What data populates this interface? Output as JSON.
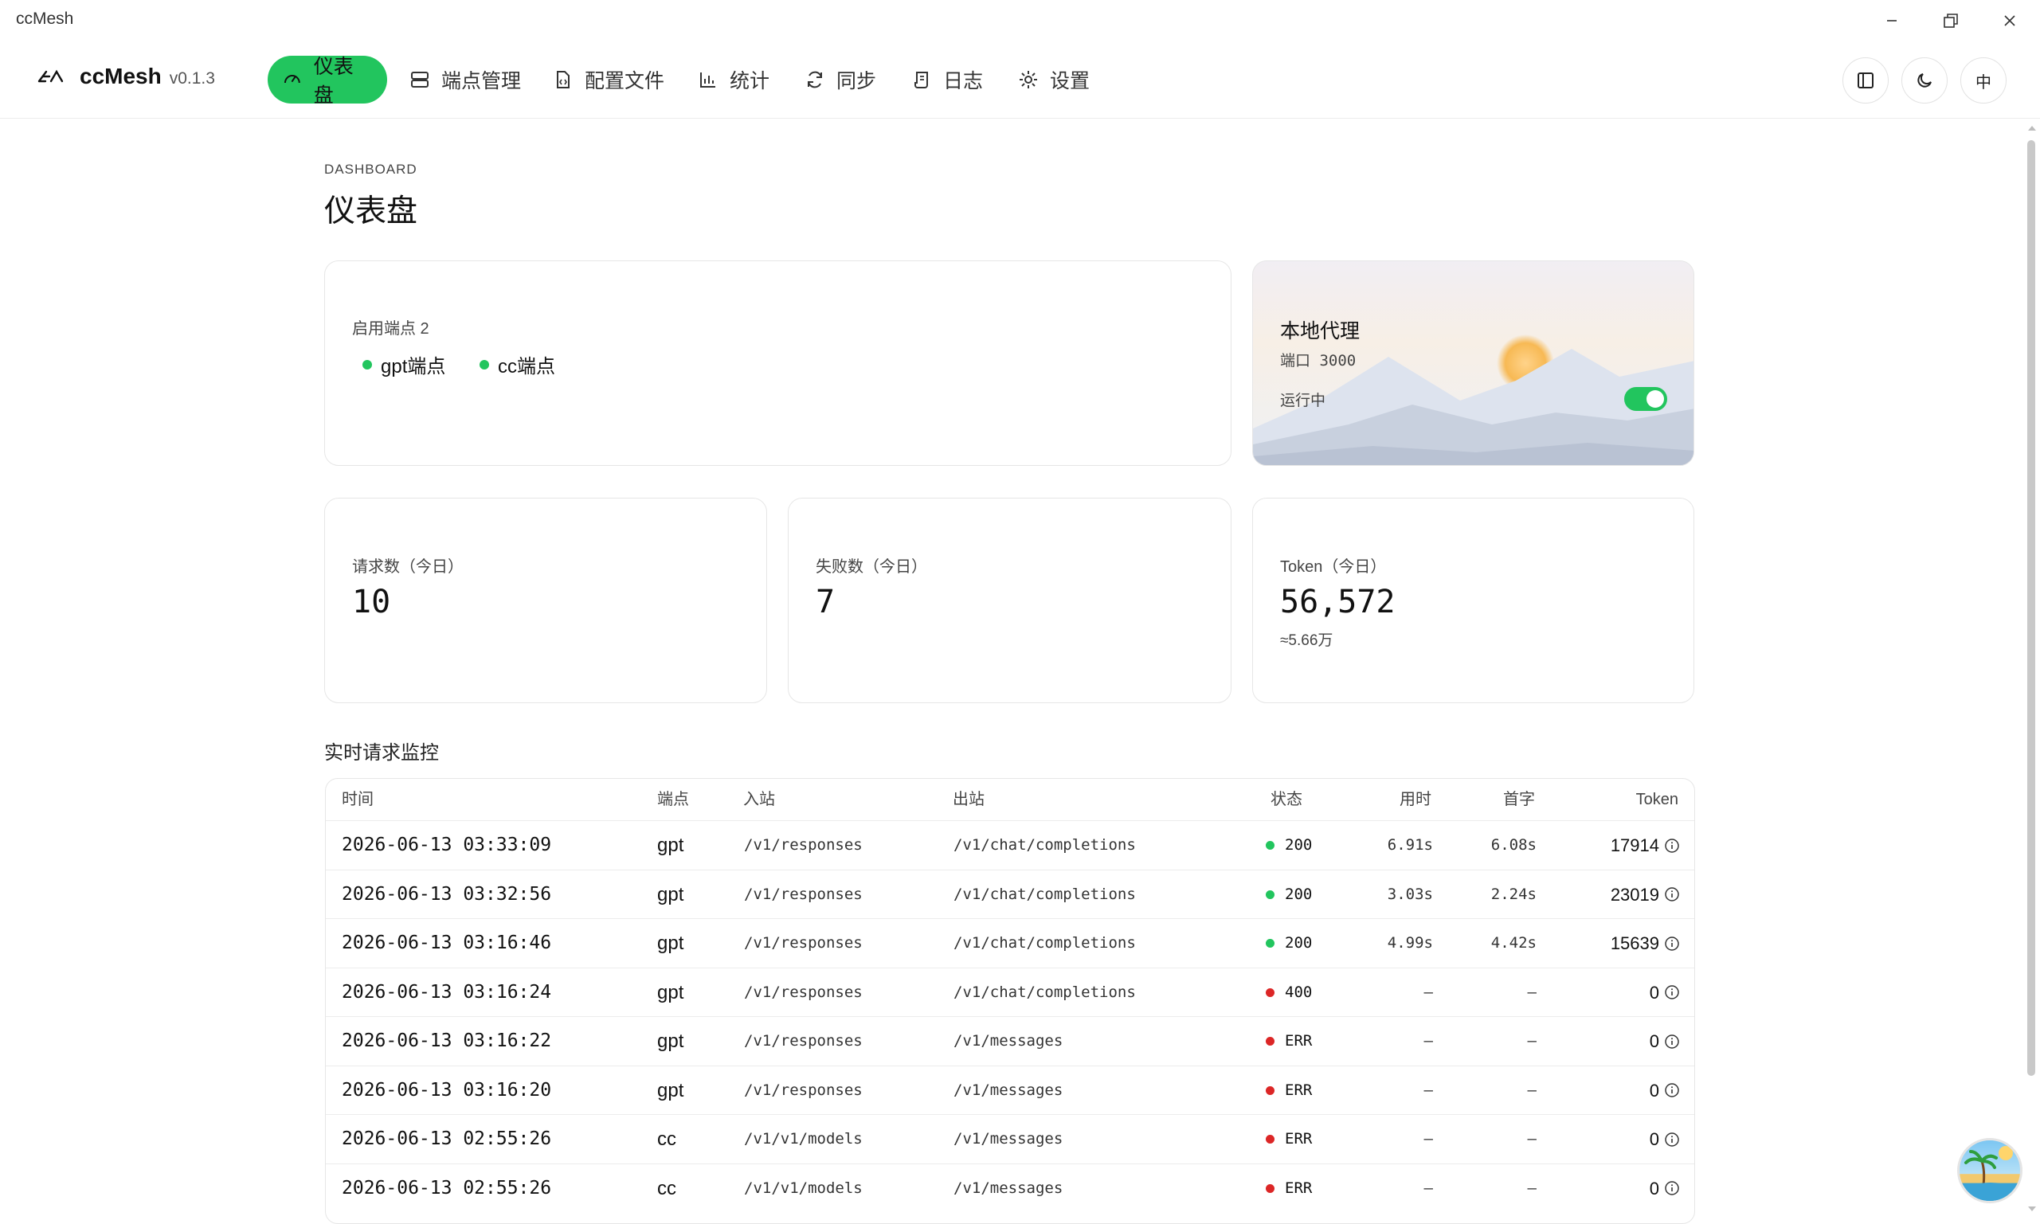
{
  "window": {
    "title": "ccMesh"
  },
  "brand": {
    "name": "ccMesh",
    "version": "v0.1.3"
  },
  "nav": {
    "dashboard": "仪表盘",
    "endpoints": "端点管理",
    "config": "配置文件",
    "stats": "统计",
    "sync": "同步",
    "logs": "日志",
    "settings": "设置"
  },
  "header_actions": {
    "language": "中"
  },
  "page": {
    "eyebrow": "DASHBOARD",
    "title": "仪表盘"
  },
  "endpoints_card": {
    "label": "启用端点 2",
    "items": [
      {
        "name": "gpt端点",
        "status_color": "#22c55e"
      },
      {
        "name": "cc端点",
        "status_color": "#22c55e"
      }
    ]
  },
  "proxy_card": {
    "title": "本地代理",
    "port": "端口 3000",
    "status": "运行中",
    "enabled": true
  },
  "stats": {
    "requests": {
      "label": "请求数（今日）",
      "value": "10"
    },
    "failures": {
      "label": "失败数（今日）",
      "value": "7"
    },
    "tokens": {
      "label": "Token（今日）",
      "value": "56,572",
      "approx": "≈5.66万"
    }
  },
  "monitor": {
    "title": "实时请求监控",
    "columns": {
      "time": "时间",
      "endpoint": "端点",
      "inbound": "入站",
      "outbound": "出站",
      "status": "状态",
      "duration": "用时",
      "first_token": "首字",
      "token": "Token"
    },
    "rows": [
      {
        "time": "2026-06-13 03:33:09",
        "endpoint": "gpt",
        "inbound": "/v1/responses",
        "outbound": "/v1/chat/completions",
        "status": "200",
        "status_color": "#22c55e",
        "duration": "6.91s",
        "first_token": "6.08s",
        "token": "17914"
      },
      {
        "time": "2026-06-13 03:32:56",
        "endpoint": "gpt",
        "inbound": "/v1/responses",
        "outbound": "/v1/chat/completions",
        "status": "200",
        "status_color": "#22c55e",
        "duration": "3.03s",
        "first_token": "2.24s",
        "token": "23019"
      },
      {
        "time": "2026-06-13 03:16:46",
        "endpoint": "gpt",
        "inbound": "/v1/responses",
        "outbound": "/v1/chat/completions",
        "status": "200",
        "status_color": "#22c55e",
        "duration": "4.99s",
        "first_token": "4.42s",
        "token": "15639"
      },
      {
        "time": "2026-06-13 03:16:24",
        "endpoint": "gpt",
        "inbound": "/v1/responses",
        "outbound": "/v1/chat/completions",
        "status": "400",
        "status_color": "#dc2626",
        "duration": "—",
        "first_token": "—",
        "token": "0"
      },
      {
        "time": "2026-06-13 03:16:22",
        "endpoint": "gpt",
        "inbound": "/v1/responses",
        "outbound": "/v1/messages",
        "status": "ERR",
        "status_color": "#dc2626",
        "duration": "—",
        "first_token": "—",
        "token": "0"
      },
      {
        "time": "2026-06-13 03:16:20",
        "endpoint": "gpt",
        "inbound": "/v1/responses",
        "outbound": "/v1/messages",
        "status": "ERR",
        "status_color": "#dc2626",
        "duration": "—",
        "first_token": "—",
        "token": "0"
      },
      {
        "time": "2026-06-13 02:55:26",
        "endpoint": "cc",
        "inbound": "/v1/v1/models",
        "outbound": "/v1/messages",
        "status": "ERR",
        "status_color": "#dc2626",
        "duration": "—",
        "first_token": "—",
        "token": "0"
      },
      {
        "time": "2026-06-13 02:55:26",
        "endpoint": "cc",
        "inbound": "/v1/v1/models",
        "outbound": "/v1/messages",
        "status": "ERR",
        "status_color": "#dc2626",
        "duration": "—",
        "first_token": "—",
        "token": "0"
      }
    ]
  },
  "colors": {
    "accent": "#22c55e",
    "error": "#dc2626"
  }
}
